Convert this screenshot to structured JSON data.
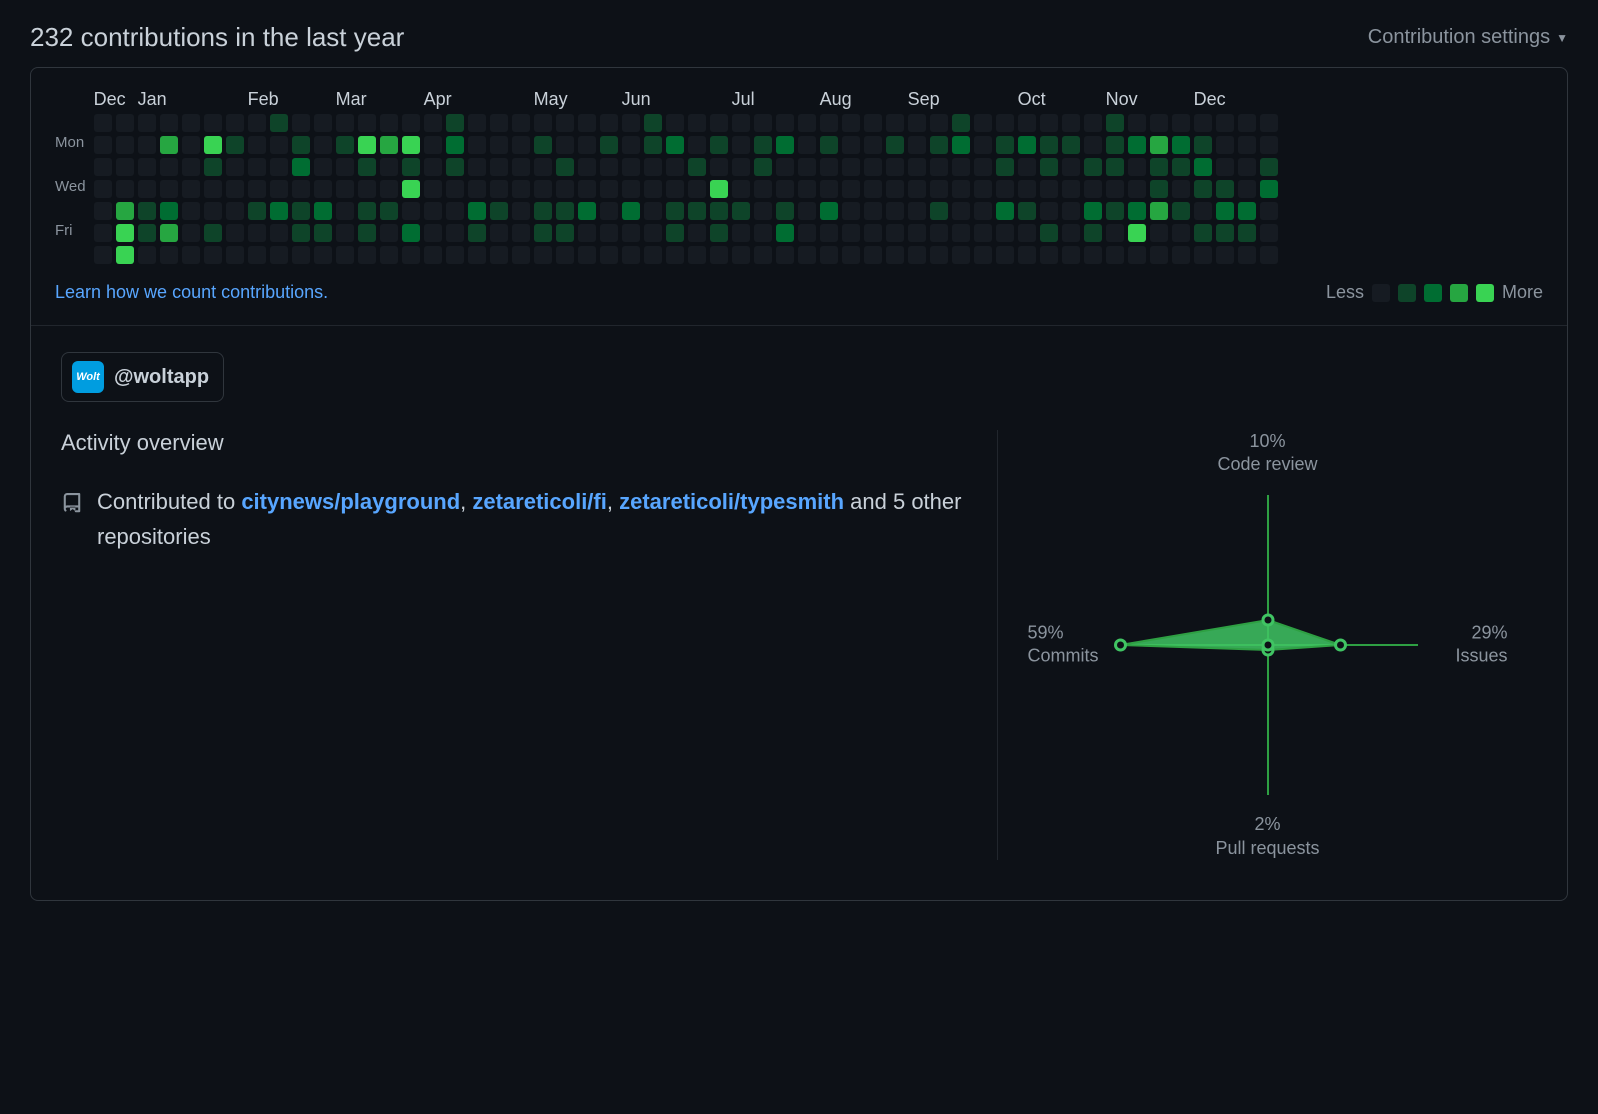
{
  "header": {
    "title": "232 contributions in the last year",
    "settings_label": "Contribution settings"
  },
  "calendar": {
    "months": [
      "Dec",
      "Jan",
      "Feb",
      "Mar",
      "Apr",
      "May",
      "Jun",
      "Jul",
      "Aug",
      "Sep",
      "Oct",
      "Nov",
      "Dec"
    ],
    "month_spans": [
      2,
      5,
      4,
      4,
      5,
      4,
      5,
      4,
      4,
      5,
      4,
      4,
      4
    ],
    "day_labels": [
      "",
      "Mon",
      "",
      "Wed",
      "",
      "Fri",
      ""
    ],
    "learn_link": "Learn how we count contributions.",
    "legend_less": "Less",
    "legend_more": "More",
    "weeks": [
      [
        0,
        0,
        0,
        0,
        0,
        0,
        0
      ],
      [
        0,
        0,
        0,
        0,
        3,
        4,
        4
      ],
      [
        0,
        0,
        0,
        0,
        1,
        1,
        0
      ],
      [
        0,
        3,
        0,
        0,
        2,
        3,
        0
      ],
      [
        0,
        0,
        0,
        0,
        0,
        0,
        0
      ],
      [
        0,
        4,
        1,
        0,
        0,
        1,
        0
      ],
      [
        0,
        1,
        0,
        0,
        0,
        0,
        0
      ],
      [
        0,
        0,
        0,
        0,
        1,
        0,
        0
      ],
      [
        1,
        0,
        0,
        0,
        2,
        0,
        0
      ],
      [
        0,
        1,
        2,
        0,
        1,
        1,
        0
      ],
      [
        0,
        0,
        0,
        0,
        2,
        1,
        0
      ],
      [
        0,
        1,
        0,
        0,
        0,
        0,
        0
      ],
      [
        0,
        4,
        1,
        0,
        1,
        1,
        0
      ],
      [
        0,
        3,
        0,
        0,
        1,
        0,
        0
      ],
      [
        0,
        4,
        1,
        4,
        0,
        2,
        0
      ],
      [
        0,
        0,
        0,
        0,
        0,
        0,
        0
      ],
      [
        1,
        2,
        1,
        0,
        0,
        0,
        0
      ],
      [
        0,
        0,
        0,
        0,
        2,
        1,
        0
      ],
      [
        0,
        0,
        0,
        0,
        1,
        0,
        0
      ],
      [
        0,
        0,
        0,
        0,
        0,
        0,
        0
      ],
      [
        0,
        1,
        0,
        0,
        1,
        1,
        0
      ],
      [
        0,
        0,
        1,
        0,
        1,
        1,
        0
      ],
      [
        0,
        0,
        0,
        0,
        2,
        0,
        0
      ],
      [
        0,
        1,
        0,
        0,
        0,
        0,
        0
      ],
      [
        0,
        0,
        0,
        0,
        2,
        0,
        0
      ],
      [
        1,
        1,
        0,
        0,
        0,
        0,
        0
      ],
      [
        0,
        2,
        0,
        0,
        1,
        1,
        0
      ],
      [
        0,
        0,
        1,
        0,
        1,
        0,
        0
      ],
      [
        0,
        1,
        0,
        4,
        1,
        1,
        0
      ],
      [
        0,
        0,
        0,
        0,
        1,
        0,
        0
      ],
      [
        0,
        1,
        1,
        0,
        0,
        0,
        0
      ],
      [
        0,
        2,
        0,
        0,
        1,
        2,
        0
      ],
      [
        0,
        0,
        0,
        0,
        0,
        0,
        0
      ],
      [
        0,
        1,
        0,
        0,
        2,
        0,
        0
      ],
      [
        0,
        0,
        0,
        0,
        0,
        0,
        0
      ],
      [
        0,
        0,
        0,
        0,
        0,
        0,
        0
      ],
      [
        0,
        1,
        0,
        0,
        0,
        0,
        0
      ],
      [
        0,
        0,
        0,
        0,
        0,
        0,
        0
      ],
      [
        0,
        1,
        0,
        0,
        1,
        0,
        0
      ],
      [
        1,
        2,
        0,
        0,
        0,
        0,
        0
      ],
      [
        0,
        0,
        0,
        0,
        0,
        0,
        0
      ],
      [
        0,
        1,
        1,
        0,
        2,
        0,
        0
      ],
      [
        0,
        2,
        0,
        0,
        1,
        0,
        0
      ],
      [
        0,
        1,
        1,
        0,
        0,
        1,
        0
      ],
      [
        0,
        1,
        0,
        0,
        0,
        0,
        0
      ],
      [
        0,
        0,
        1,
        0,
        2,
        1,
        0
      ],
      [
        1,
        1,
        1,
        0,
        1,
        0,
        0
      ],
      [
        0,
        2,
        0,
        0,
        2,
        4,
        0
      ],
      [
        0,
        3,
        1,
        1,
        3,
        0,
        0
      ],
      [
        0,
        2,
        1,
        0,
        1,
        0,
        0
      ],
      [
        0,
        1,
        2,
        1,
        0,
        1,
        0
      ],
      [
        0,
        0,
        0,
        1,
        2,
        1,
        0
      ],
      [
        0,
        0,
        0,
        0,
        2,
        1,
        0
      ],
      [
        0,
        0,
        1,
        2,
        0,
        0,
        0
      ]
    ]
  },
  "org": {
    "logo_text": "Wolt",
    "handle": "@woltapp"
  },
  "overview": {
    "heading": "Activity overview",
    "prefix": "Contributed to ",
    "repos": [
      "citynews/playground",
      "zetareticoli/fi",
      "zetareticoli/typesmith"
    ],
    "suffix": " and 5 other repositories"
  },
  "chart_data": {
    "type": "radar",
    "axes": [
      "Code review",
      "Issues",
      "Pull requests",
      "Commits"
    ],
    "values_pct": [
      10,
      29,
      2,
      59
    ],
    "labels": {
      "top": {
        "pct": "10%",
        "name": "Code review"
      },
      "right": {
        "pct": "29%",
        "name": "Issues"
      },
      "bottom": {
        "pct": "2%",
        "name": "Pull requests"
      },
      "left": {
        "pct": "59%",
        "name": "Commits"
      }
    },
    "color": "#40c463"
  }
}
